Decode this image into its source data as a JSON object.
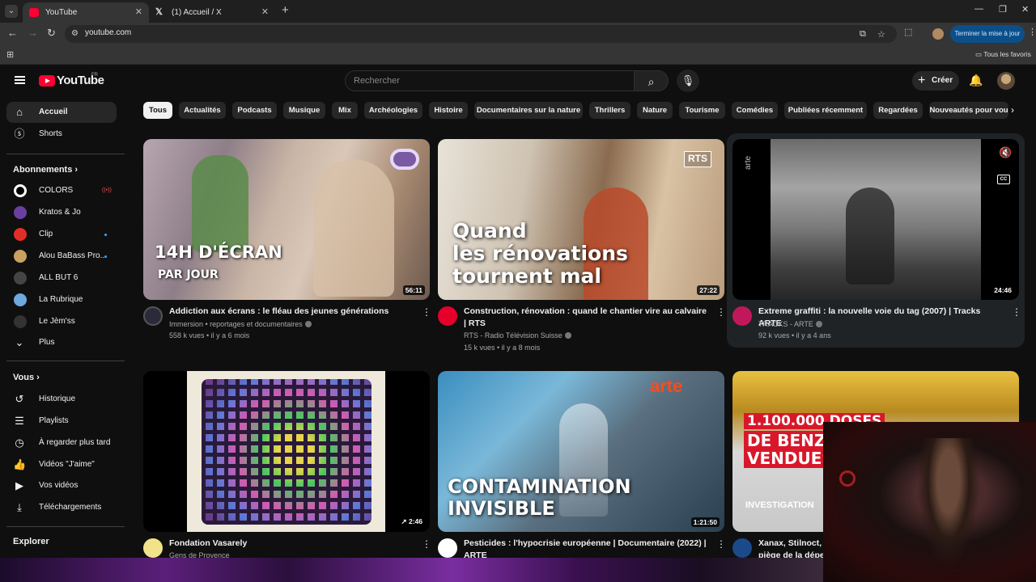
{
  "browser": {
    "tabs": [
      {
        "title": "YouTube",
        "active": true
      },
      {
        "title": "(1) Accueil / X",
        "active": false
      }
    ],
    "url": "youtube.com",
    "update_button": "Terminer la mise à jour",
    "bookmarks_label": "Tous les favoris"
  },
  "header": {
    "logo": "YouTube",
    "region": "FR",
    "search_placeholder": "Rechercher",
    "create_label": "Créer"
  },
  "sidebar": {
    "main": [
      {
        "label": "Accueil",
        "icon": "home-icon",
        "active": true
      },
      {
        "label": "Shorts",
        "icon": "shorts-icon",
        "active": false
      }
    ],
    "subscriptions_title": "Abonnements",
    "subscriptions": [
      {
        "label": "COLORS",
        "color": "#ffffff",
        "badge": "live"
      },
      {
        "label": "Kratos & Jo",
        "color": "#6b3fa0",
        "badge": ""
      },
      {
        "label": "Clip",
        "color": "#e52d27",
        "badge": "dot"
      },
      {
        "label": "Alou BaBass Pro...",
        "color": "#c8a060",
        "badge": "dot"
      },
      {
        "label": "ALL BUT 6",
        "color": "#444444",
        "badge": ""
      },
      {
        "label": "La Rubrique",
        "color": "#6fa8dc",
        "badge": ""
      },
      {
        "label": "Le Jèm'ss",
        "color": "#333333",
        "badge": ""
      }
    ],
    "more_label": "Plus",
    "you_title": "Vous",
    "you_items": [
      {
        "label": "Historique",
        "icon": "history-icon"
      },
      {
        "label": "Playlists",
        "icon": "playlists-icon"
      },
      {
        "label": "À regarder plus tard",
        "icon": "watch-later-icon"
      },
      {
        "label": "Vidéos \"J'aime\"",
        "icon": "like-icon"
      },
      {
        "label": "Vos vidéos",
        "icon": "your-videos-icon"
      },
      {
        "label": "Téléchargements",
        "icon": "downloads-icon"
      }
    ],
    "explore_title": "Explorer"
  },
  "chips": [
    "Tous",
    "Actualités",
    "Podcasts",
    "Musique",
    "Mix",
    "Archéologies",
    "Histoire",
    "Documentaires sur la nature",
    "Thrillers",
    "Nature",
    "Tourisme",
    "Comédies",
    "Publiées récemment",
    "Regardées",
    "Nouveautés pour vou"
  ],
  "videos": [
    {
      "title": "Addiction aux écrans : le fléau des jeunes générations",
      "channel": "Immersion • reportages et documentaires",
      "stats": "558 k vues • il y a 6 mois",
      "duration": "56:11",
      "thumb_text": [
        "14H D'ÉCRAN",
        "PAR JOUR"
      ]
    },
    {
      "title": "Construction, rénovation : quand le chantier vire au calvaire | RTS",
      "channel": "RTS - Radio Télévision Suisse",
      "stats": "15 k vues • il y a 8 mois",
      "duration": "27:22",
      "thumb_text": [
        "Quand",
        "les rénovations",
        "tournent mal"
      ],
      "badge": "RTS"
    },
    {
      "title": "Extreme graffiti : la nouvelle voie du tag (2007) | Tracks ARTE",
      "channel": "TRACKS - ARTE",
      "stats": "92 k vues • il y a 4 ans",
      "duration": "24:46",
      "badge": "arte"
    },
    {
      "title": "Fondation Vasarely",
      "channel": "Gens de Provence",
      "duration": "2:46"
    },
    {
      "title": "Pesticides : l'hypocrisie européenne | Documentaire (2022) | ARTE",
      "duration": "1:21:50",
      "thumb_text": [
        "CONTAMINATION",
        "INVISIBLE"
      ],
      "badge": "arte"
    },
    {
      "title": "Xanax, Stilnoct, Z",
      "title2": "piège de la dépe",
      "thumb_text": [
        "1.100.000 DOSES",
        "DE BENZ",
        "VENDUES"
      ],
      "badge": "INVESTIGATION"
    }
  ]
}
